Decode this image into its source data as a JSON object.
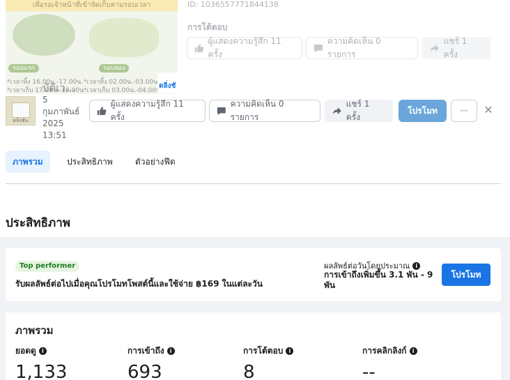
{
  "preview": {
    "banner_text": "เพื่อรอเจ้าหน้าที่เข้าจัดเก็บตามรอบเวลา",
    "round1_label": "รอบแรก",
    "round2_label": "รอบสอง",
    "round1_times": [
      "*เวลาทิ้ง 16.00น.-17.00น.",
      "*เวลาเก็บ 17.00น.-18.00น."
    ],
    "round2_times": [
      "*เวลาทิ้ง 02.00น.-03.00น.",
      "*เวลาเก็บ 03.00น.-04.00น."
    ],
    "side_text": "ตลิ่งชั"
  },
  "post_id": "ID: 1036557771844138",
  "reply_heading": "การโต้ตอบ",
  "faded_actions": {
    "reactions": "ผู้แสดงความรู้สึก 11 ครั้ง",
    "comments": "ความคิดเห็น 0 รายการ",
    "shares": "แชร์ 1 ครั้ง"
  },
  "post": {
    "title": "บัติเว...",
    "date_lines": [
      "5",
      "กุมภาพันธ์",
      "2025",
      "13:51"
    ],
    "thumb_caption": "ตลิ่งชัน"
  },
  "actions": {
    "reactions": "ผู้แสดงความรู้สึก 11 ครั้ง",
    "comments": "ความคิดเห็น 0 รายการ",
    "shares": "แชร์ 1 ครั้ง",
    "promote": "โปรโมท",
    "more": "···",
    "close": "✕"
  },
  "tabs": [
    {
      "label": "ภาพรวม",
      "active": true
    },
    {
      "label": "ประสิทธิภาพ",
      "active": false
    },
    {
      "label": "ตัวอย่างฟีด",
      "active": false
    }
  ],
  "section_title": "ประสิทธิภาพ",
  "performer": {
    "badge": "Top performer",
    "description": "รับผลลัพธ์ต่อไปเมื่อคุณโปรโมทโพสต์นี้และใช้จ่าย ฿169 ในแต่ละวัน",
    "estimate_label": "ผลลัพธ์ต่อวันโดยประมาณ",
    "estimate_value": "การเข้าถึงเพิ่มขึ้น 3.1 พัน - 9 พัน",
    "promote_label": "โปรโมท"
  },
  "overview": {
    "title": "ภาพรวม",
    "metrics": [
      {
        "label": "ยอดดู",
        "value": "1,133"
      },
      {
        "label": "การเข้าถึง",
        "value": "693"
      },
      {
        "label": "การโต้ตอบ",
        "value": "8"
      },
      {
        "label": "การคลิกลิงก์",
        "value": "--"
      }
    ]
  },
  "colors": {
    "accent": "#1b74e4",
    "active_tab_bg": "#e7f3ff",
    "badge_bg": "#e6f5e1",
    "badge_text": "#1f7a1f",
    "page_bg": "#f0f2f5"
  }
}
